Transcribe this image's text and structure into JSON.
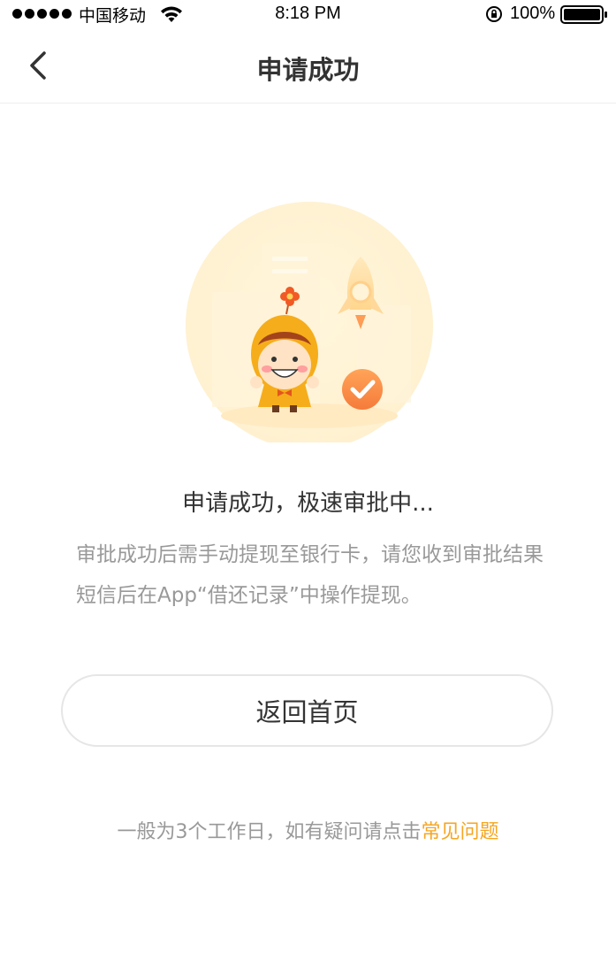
{
  "status_bar": {
    "carrier": "中国移动",
    "time": "8:18 PM",
    "battery": "100%"
  },
  "nav": {
    "title": "申请成功"
  },
  "main": {
    "headline": "申请成功，极速审批中...",
    "description": "审批成功后需手动提现至银行卡，请您收到审批结果短信后在App“借还记录”中操作提现。",
    "home_button": "返回首页"
  },
  "footer": {
    "note": "一般为3个工作日，如有疑问请点击",
    "faq_link": "常见问题"
  },
  "colors": {
    "accent": "#f5a623",
    "muted_text": "#999999",
    "primary_text": "#333333"
  },
  "icons": {
    "back": "chevron-left-icon",
    "wifi": "wifi-icon",
    "rotation_lock": "rotation-lock-icon",
    "battery": "battery-icon",
    "check": "check-circle-icon"
  }
}
